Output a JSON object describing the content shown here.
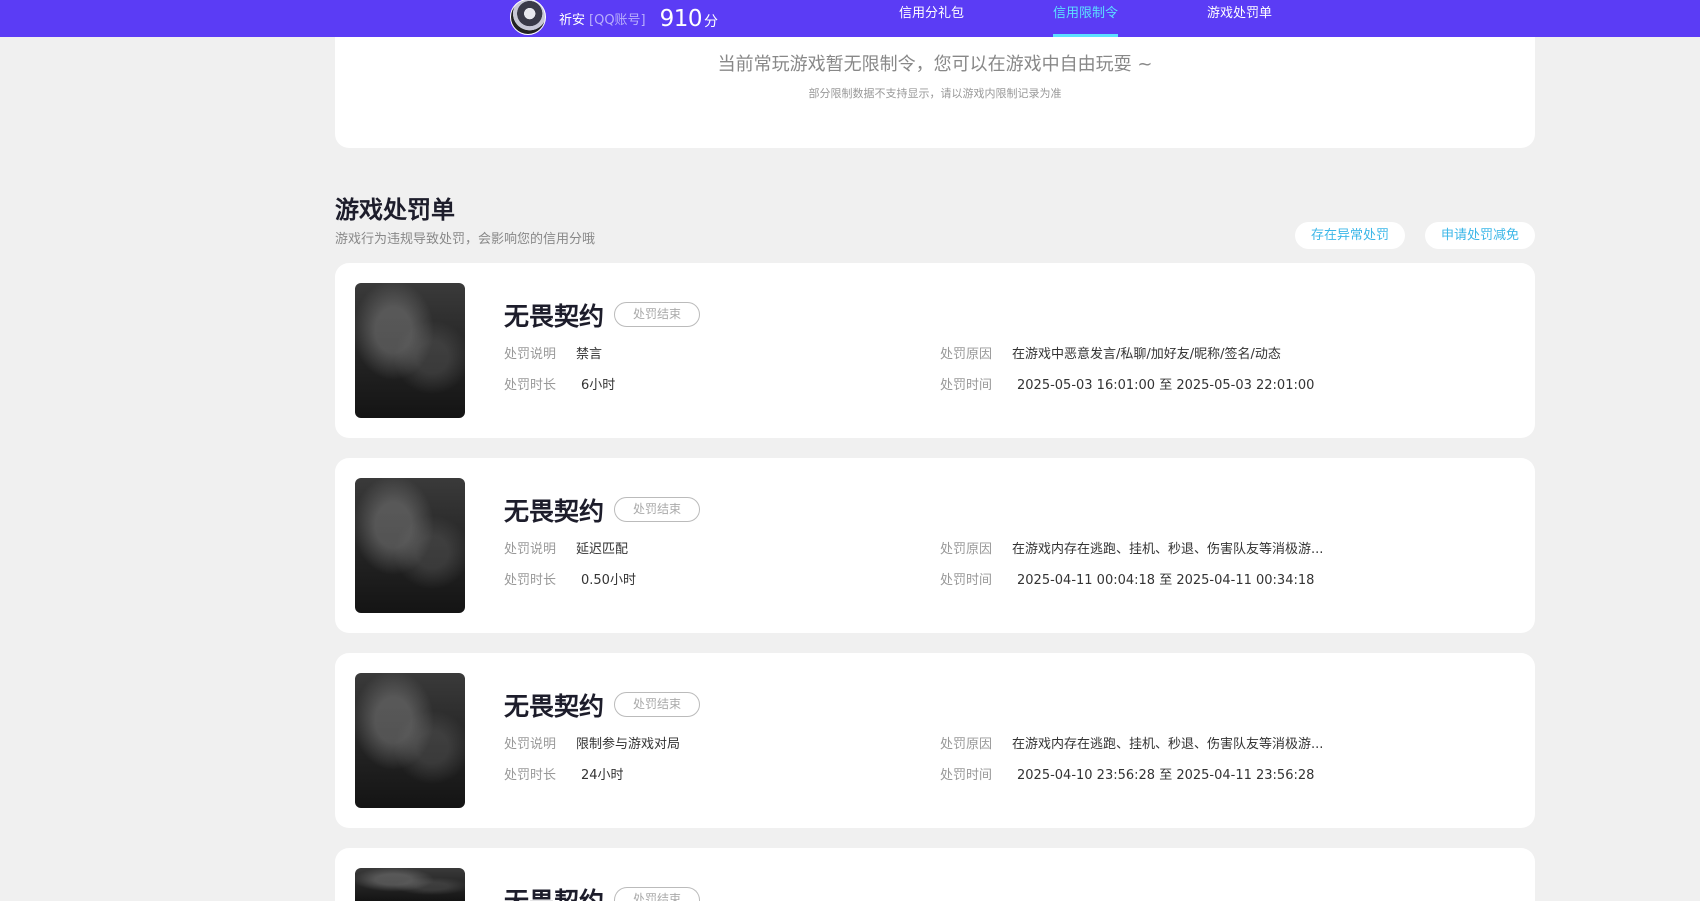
{
  "header": {
    "user_name": "祈安",
    "account_type": "[QQ账号]",
    "score": "910",
    "score_unit": "分",
    "nav": [
      {
        "label": "信用分礼包",
        "active": false
      },
      {
        "label": "信用限制令",
        "active": true
      },
      {
        "label": "游戏处罚单",
        "active": false
      }
    ]
  },
  "restriction": {
    "message": "当前常玩游戏暂无限制令，您可以在游戏中自由玩耍 ~",
    "note": "部分限制数据不支持显示，请以游戏内限制记录为准"
  },
  "penalties": {
    "title": "游戏处罚单",
    "subtitle": "游戏行为违规导致处罚，会影响您的信用分哦",
    "buttons": {
      "abnormal": "存在异常处罚",
      "reduce": "申请处罚减免"
    },
    "labels": {
      "desc": "处罚说明",
      "duration": "处罚时长",
      "reason": "处罚原因",
      "time": "处罚时间"
    },
    "items": [
      {
        "game": "无畏契约",
        "status": "处罚结束",
        "desc": "禁言",
        "duration": "6小时",
        "reason": "在游戏中恶意发言/私聊/加好友/昵称/签名/动态",
        "time": "2025-05-03 16:01:00 至 2025-05-03 22:01:00"
      },
      {
        "game": "无畏契约",
        "status": "处罚结束",
        "desc": "延迟匹配",
        "duration": "0.50小时",
        "reason": "在游戏内存在逃跑、挂机、秒退、伤害队友等消极游...",
        "time": "2025-04-11 00:04:18 至 2025-04-11 00:34:18"
      },
      {
        "game": "无畏契约",
        "status": "处罚结束",
        "desc": "限制参与游戏对局",
        "duration": "24小时",
        "reason": "在游戏内存在逃跑、挂机、秒退、伤害队友等消极游...",
        "time": "2025-04-10 23:56:28 至 2025-04-11 23:56:28"
      },
      {
        "game": "无畏契约",
        "status": "处罚结束"
      }
    ]
  }
}
